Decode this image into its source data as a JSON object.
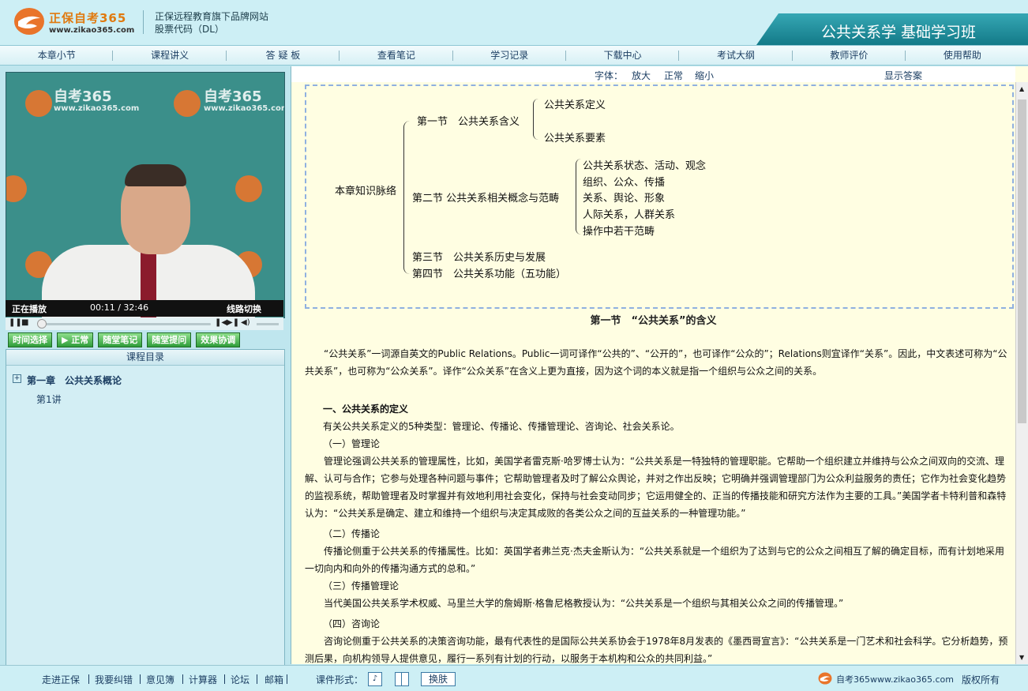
{
  "header": {
    "logo_text": "正保自考365",
    "logo_url": "www.zikao365.com",
    "tagline_1": "正保远程教育旗下品牌网站",
    "tagline_2": "股票代码（DL）",
    "course_title": "公共关系学 基础学习班"
  },
  "nav": [
    "本章小节",
    "课程讲义",
    "答 疑 板",
    "查看笔记",
    "学习记录",
    "下载中心",
    "考试大纲",
    "教师评价",
    "使用帮助"
  ],
  "player": {
    "status": "正在播放",
    "time": "00:11 / 32:46",
    "line_switch": "线路切换",
    "watermark_brand": "自考365",
    "watermark_url": "www.zikao365.com",
    "buttons": [
      "时间选择",
      "▶ 正常",
      "随堂笔记",
      "随堂提问",
      "效果协调"
    ]
  },
  "toc": {
    "header": "课程目录",
    "chapter": "第一章　公共关系概论",
    "lesson": "第1讲"
  },
  "fontbar": {
    "label": "字体：",
    "enlarge": "放大",
    "normal": "正常",
    "shrink": "缩小",
    "show_answer": "显示答案"
  },
  "tree": {
    "root": "本章知识脉络",
    "s1": "第一节　公共关系含义",
    "s1a": "公共关系定义",
    "s1b": "公共关系要素",
    "s2": "第二节 公共关系相关概念与范畴",
    "s2items": [
      "公共关系状态、活动、观念",
      "组织、公众、传播",
      "关系、舆论、形象",
      "人际关系，人群关系",
      "操作中若干范畴"
    ],
    "s3": "第三节　公共关系历史与发展",
    "s4": "第四节　公共关系功能（五功能）"
  },
  "article": {
    "section_title": "第一节　“公共关系”的含义",
    "intro": "“公共关系”一词源自英文的Public Relations。Public一词可译作“公共的”、“公开的”，也可译作“公众的”；Relations则宜译作“关系”。因此，中文表述可称为“公共关系”，也可称为“公众关系”。译作“公众关系”在含义上更为直接，因为这个词的本义就是指一个组织与公众之间的关系。",
    "h1": "一、公共关系的定义",
    "p1": "有关公共关系定义的5种类型：管理论、传播论、传播管理论、咨询论、社会关系论。",
    "h_a": "（一）管理论",
    "p_a": "管理论强调公共关系的管理属性，比如，美国学者雷克斯·哈罗博士认为：“公共关系是一特独特的管理职能。它帮助一个组织建立并维持与公众之间双向的交流、理解、认可与合作；它参与处理各种问题与事件；它帮助管理者及时了解公众舆论，并对之作出反映；它明确并强调管理部门为公众利益服务的责任；它作为社会变化趋势的监视系统，帮助管理者及时掌握并有效地利用社会变化，保持与社会变动同步；它运用健全的、正当的传播技能和研究方法作为主要的工具。”美国学者卡特利普和森特认为：“公共关系是确定、建立和维持一个组织与决定其成败的各类公众之间的互益关系的一种管理功能。”",
    "h_b": "（二）传播论",
    "p_b": "传播论侧重于公共关系的传播属性。比如：英国学者弗兰克·杰夫金斯认为：“公共关系就是一个组织为了达到与它的公众之间相互了解的确定目标，而有计划地采用一切向内和向外的传播沟通方式的总和。”",
    "h_c": "（三）传播管理论",
    "p_c": "当代美国公共关系学术权威、马里兰大学的詹姆斯·格鲁尼格教授认为：“公共关系是一个组织与其相关公众之间的传播管理。”",
    "h_d": "（四）咨询论",
    "p_d": "咨询论侧重于公共关系的决策咨询功能，最有代表性的是国际公共关系协会于1978年8月发表的《墨西哥宣言》：“公共关系是一门艺术和社会科学。它分析趋势，预测后果，向机构领导人提供意见，履行一系列有计划的行动，以服务于本机构和公众的共同利益。”"
  },
  "footer": {
    "links": [
      "走进正保",
      "我要纠错",
      "意见簿",
      "计算器",
      "论坛",
      "邮箱"
    ],
    "format_label": "课件形式：",
    "skin": "换肤",
    "brand": "自考365www.zikao365.com",
    "copyright": "版权所有"
  },
  "colors": {
    "accent": "#1d3f63",
    "banner": "#137a88",
    "content_bg": "#fffee2",
    "green_button": "#2f9d3a"
  }
}
